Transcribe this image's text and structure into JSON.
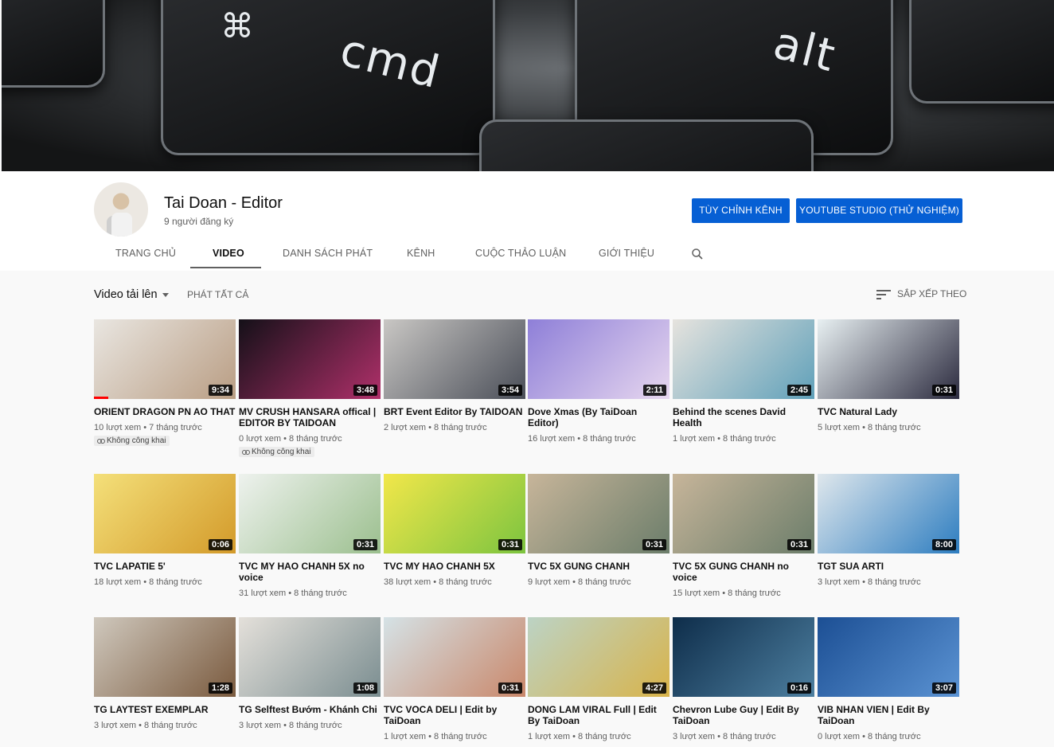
{
  "channel": {
    "name": "Tai Doan - Editor",
    "subscribers": "9 người đăng ký",
    "customize_label": "Tùy chỉnh kênh",
    "studio_label": "YouTube Studio (thử nghiệm)"
  },
  "banner": {
    "key_left": "cmd",
    "key_right": "alt"
  },
  "tabs": [
    "Trang chủ",
    "Video",
    "Danh sách phát",
    "Kênh",
    "Cuộc thảo luận",
    "Giới thiệu"
  ],
  "toolbar": {
    "uploads_label": "Video tải lên",
    "play_all": "Phát tất cả",
    "sort_label": "Sắp xếp theo"
  },
  "videos": [
    {
      "title": "ORIENT DRAGON PN AO THAT",
      "duration": "9:34",
      "meta": "10 lượt xem • 7 tháng trước",
      "badge": "Không công khai",
      "progress": 0.1,
      "colors": [
        "#e9e6e1",
        "#b99d83"
      ]
    },
    {
      "title": "MV CRUSH HANSARA offical | EDITOR BY TAIDOAN",
      "duration": "3:48",
      "meta": "0 lượt xem • 8 tháng trước",
      "badge": "Không công khai",
      "colors": [
        "#141018",
        "#b0306a"
      ]
    },
    {
      "title": "BRT Event Editor By TAIDOAN",
      "duration": "3:54",
      "meta": "2 lượt xem • 8 tháng trước",
      "colors": [
        "#c9c7c4",
        "#4a4e58"
      ]
    },
    {
      "title": "Dove Xmas (By TaiDoan Editor)",
      "duration": "2:11",
      "meta": "16 lượt xem • 8 tháng trước",
      "colors": [
        "#8e7fd8",
        "#e7d7ef"
      ]
    },
    {
      "title": "Behind the scenes David Health",
      "duration": "2:45",
      "meta": "1 lượt xem • 8 tháng trước",
      "colors": [
        "#e6e3de",
        "#5fa0b9"
      ]
    },
    {
      "title": "TVC Natural Lady",
      "duration": "0:31",
      "meta": "5 lượt xem • 8 tháng trước",
      "colors": [
        "#e8f0f2",
        "#2b2a3e"
      ]
    },
    {
      "title": "TVC LAPATIE 5'",
      "duration": "0:06",
      "meta": "18 lượt xem • 8 tháng trước",
      "colors": [
        "#f4e07a",
        "#d39a2a"
      ]
    },
    {
      "title": "TVC MY HAO CHANH 5X no voice",
      "duration": "0:31",
      "meta": "31 lượt xem • 8 tháng trước",
      "colors": [
        "#eef2ee",
        "#9bbf8e"
      ]
    },
    {
      "title": "TVC MY HAO CHANH 5X",
      "duration": "0:31",
      "meta": "38 lượt xem • 8 tháng trước",
      "colors": [
        "#f2e74a",
        "#7cc43f"
      ]
    },
    {
      "title": "TVC 5X GUNG CHANH",
      "duration": "0:31",
      "meta": "9 lượt xem • 8 tháng trước",
      "colors": [
        "#c7b59a",
        "#6b7d6a"
      ]
    },
    {
      "title": "TVC 5X GUNG CHANH no voice",
      "duration": "0:31",
      "meta": "15 lượt xem • 8 tháng trước",
      "colors": [
        "#c7b59a",
        "#6b7d6a"
      ]
    },
    {
      "title": "TGT SUA ARTI",
      "duration": "8:00",
      "meta": "3 lượt xem • 8 tháng trước",
      "colors": [
        "#dfe7ec",
        "#2d7dc0"
      ]
    },
    {
      "title": "TG LAYTEST EXEMPLAR",
      "duration": "1:28",
      "meta": "3 lượt xem • 8 tháng trước",
      "colors": [
        "#cfc8bd",
        "#7a5a3e"
      ]
    },
    {
      "title": "TG Selftest Bướm - Khánh Chi",
      "duration": "1:08",
      "meta": "3 lượt xem • 8 tháng trước",
      "colors": [
        "#e4e0da",
        "#7a8d90"
      ]
    },
    {
      "title": "TVC VOCA DELI | Edit by TaiDoan",
      "duration": "0:31",
      "meta": "1 lượt xem • 8 tháng trước",
      "colors": [
        "#d5e2e6",
        "#c9876a"
      ]
    },
    {
      "title": "DONG LAM VIRAL Full | Edit By TaiDoan",
      "duration": "4:27",
      "meta": "1 lượt xem • 8 tháng trước",
      "colors": [
        "#bcd3c5",
        "#d8b34a"
      ]
    },
    {
      "title": "Chevron Lube Guy | Edit By TaiDoan",
      "duration": "0:16",
      "meta": "3 lượt xem • 8 tháng trước",
      "colors": [
        "#0e2d4a",
        "#4d7fa0"
      ]
    },
    {
      "title": "VIB NHAN VIEN | Edit By TaiDoan",
      "duration": "3:07",
      "meta": "0 lượt xem • 8 tháng trước",
      "colors": [
        "#1c4f94",
        "#5b93d3"
      ]
    }
  ]
}
